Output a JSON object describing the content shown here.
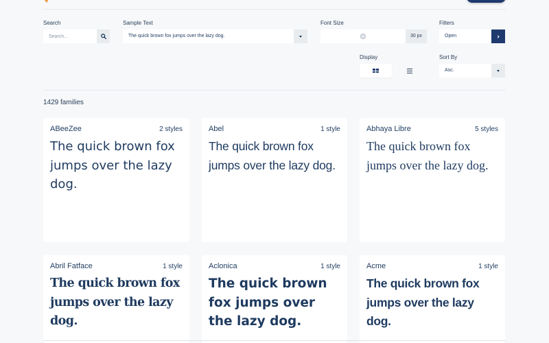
{
  "header": {
    "logo_icon": "font-logo-icon",
    "logo_text": "",
    "top_button_label": ""
  },
  "filters": {
    "search": {
      "label": "Search",
      "placeholder": "Search...",
      "value": "",
      "button_icon": "search-icon"
    },
    "sample_text": {
      "label": "Sample Text",
      "value": "The quick brown fox jumps over the lazy dog.",
      "caret_icon": "caret-down-icon"
    },
    "font_size": {
      "label": "Font Size",
      "value": 30,
      "display": "30 px",
      "slider_fraction": 0.5
    },
    "filters": {
      "label": "Filters",
      "value": "Open",
      "button_icon": "chevron-right-icon"
    },
    "display": {
      "label": "Display",
      "options": [
        "grid",
        "list"
      ],
      "selected": "grid"
    },
    "sort_by": {
      "label": "Sort By",
      "value": "Asc.",
      "caret_icon": "caret-down-icon"
    }
  },
  "results": {
    "count_label": "1429 families"
  },
  "fonts": [
    {
      "name": "ABeeZee",
      "styles": "2 styles",
      "sample": "The quick brown fox jumps over the lazy dog."
    },
    {
      "name": "Abel",
      "styles": "1 style",
      "sample": "The quick brown fox jumps over the lazy dog."
    },
    {
      "name": "Abhaya Libre",
      "styles": "5 styles",
      "sample": "The quick brown fox jumps over the lazy dog."
    },
    {
      "name": "Abril Fatface",
      "styles": "1 style",
      "sample": "The quick brown fox jumps over the lazy dog."
    },
    {
      "name": "Aclonica",
      "styles": "1 style",
      "sample": "The quick brown fox jumps over the lazy dog."
    },
    {
      "name": "Acme",
      "styles": "1 style",
      "sample": "The quick brown fox jumps over the lazy dog."
    }
  ],
  "colors": {
    "primary": "#1e3a6e",
    "text": "#1e3a5f",
    "background": "#f6f8fa",
    "accent_logo": "#f5a623"
  }
}
